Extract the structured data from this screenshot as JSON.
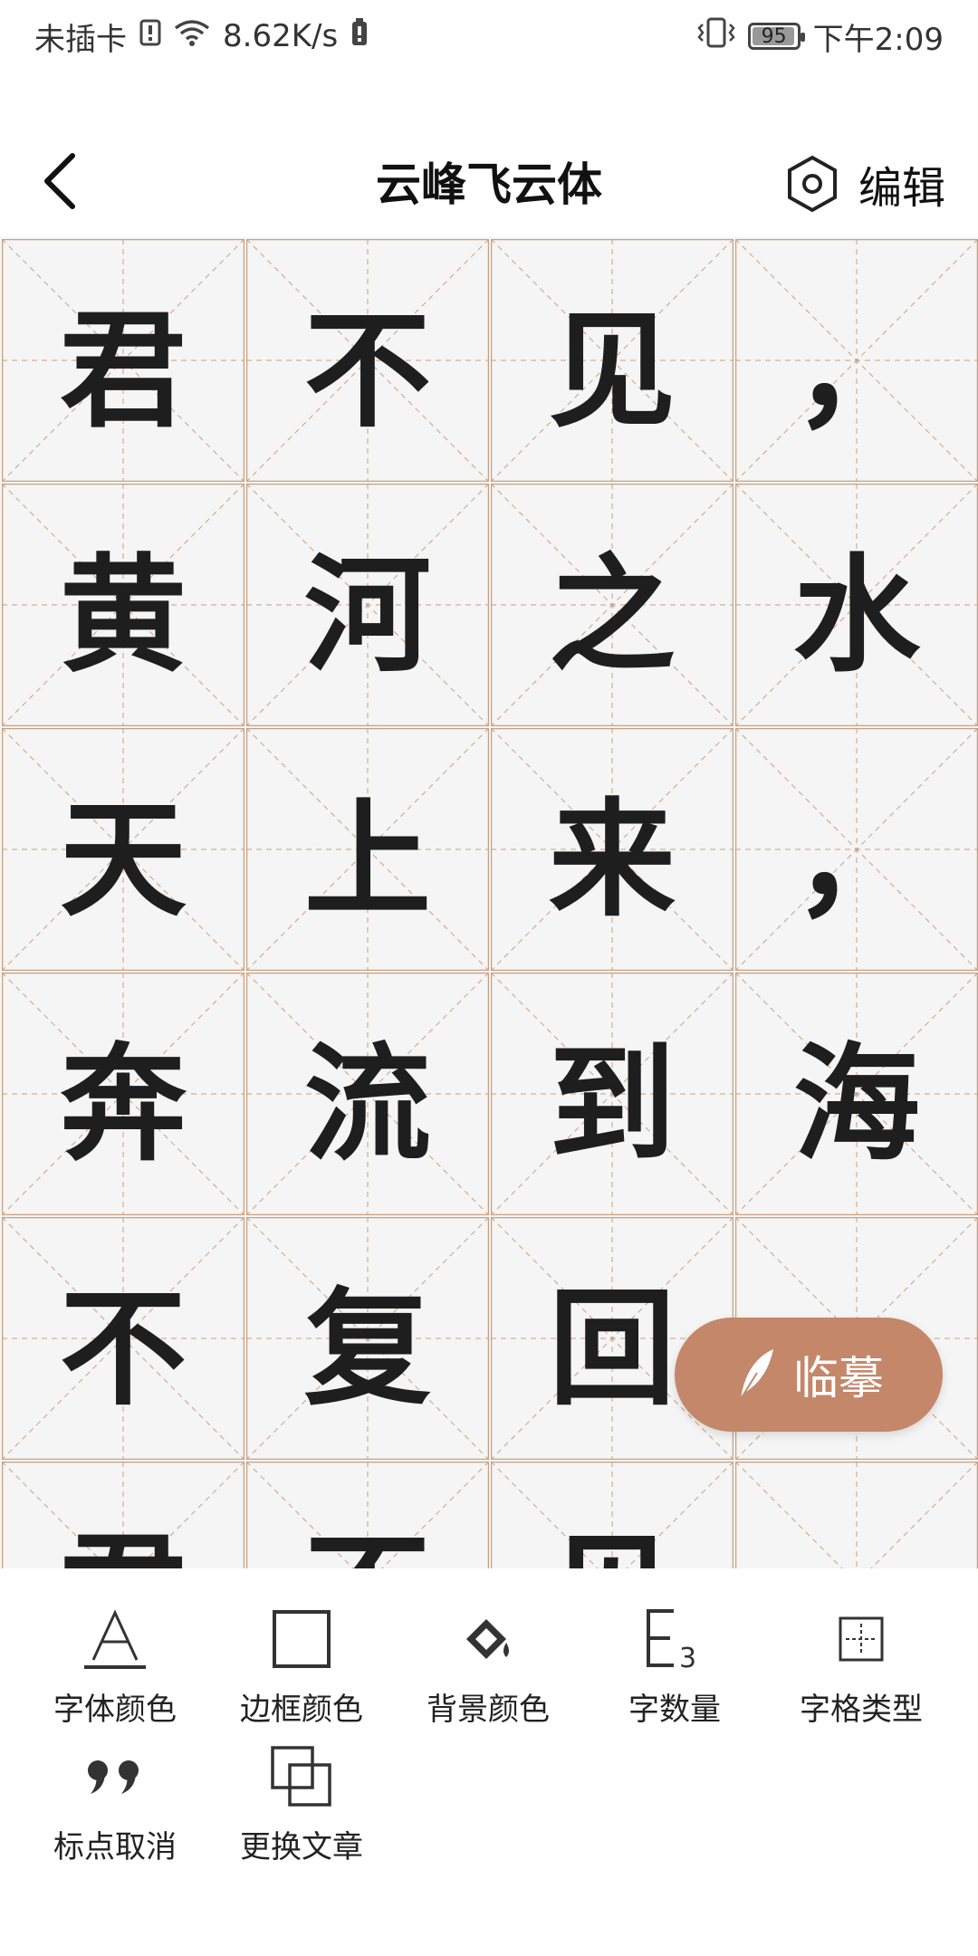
{
  "status_bar": {
    "carrier": "未插卡",
    "net_speed": "8.62K/s",
    "battery": "95",
    "time": "下午2:09"
  },
  "header": {
    "title": "云峰飞云体",
    "edit_label": "编辑"
  },
  "grid": {
    "columns": 4,
    "cells": [
      "君",
      "不",
      "见",
      "，",
      "黄",
      "河",
      "之",
      "水",
      "天",
      "上",
      "来",
      "，",
      "奔",
      "流",
      "到",
      "海",
      "不",
      "复",
      "回",
      "",
      "君",
      "不",
      "见",
      ""
    ]
  },
  "fab": {
    "label": "临摹"
  },
  "toolbar": {
    "items": [
      {
        "label": "字体颜色",
        "icon": "font-color-icon"
      },
      {
        "label": "边框颜色",
        "icon": "border-color-icon"
      },
      {
        "label": "背景颜色",
        "icon": "paint-bucket-icon"
      },
      {
        "label": "字数量",
        "icon": "char-count-icon"
      },
      {
        "label": "字格类型",
        "icon": "grid-type-icon"
      },
      {
        "label": "标点取消",
        "icon": "quote-icon"
      },
      {
        "label": "更换文章",
        "icon": "overlap-squares-icon"
      }
    ]
  },
  "colors": {
    "grid_line": "#c9a081",
    "accent": "#c4876a",
    "ink": "#1e1e1e"
  }
}
